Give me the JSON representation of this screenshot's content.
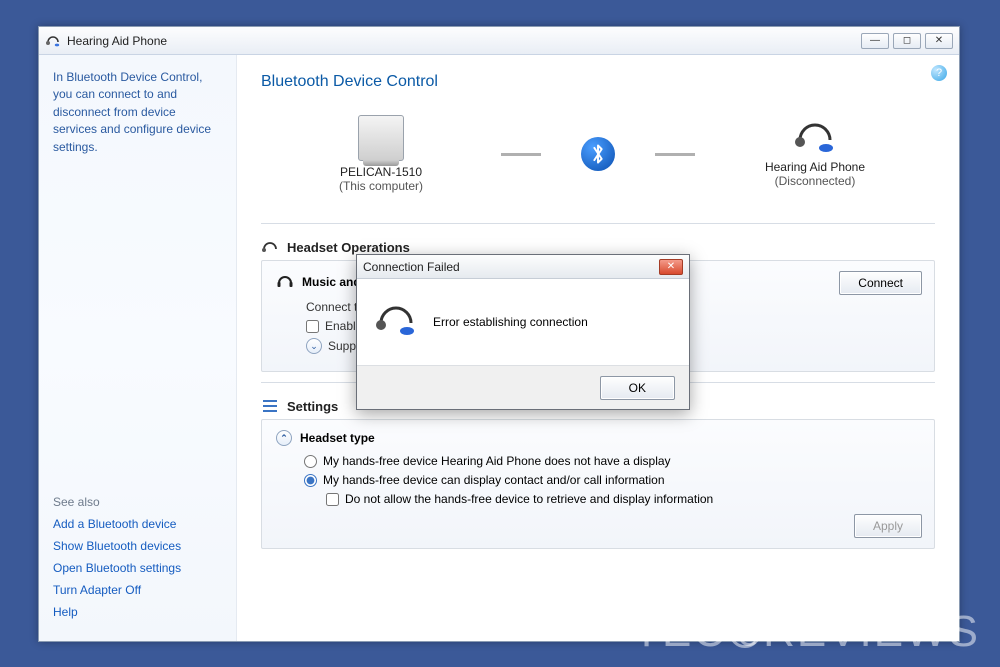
{
  "window": {
    "title": "Hearing Aid Phone",
    "help_tooltip": "?"
  },
  "sidebar": {
    "blurb": "In Bluetooth Device Control, you can connect to and disconnect from device services and configure device settings.",
    "see_also_label": "See also",
    "links": [
      "Add a Bluetooth device",
      "Show Bluetooth devices",
      "Open Bluetooth settings",
      "Turn Adapter Off",
      "Help"
    ]
  },
  "main": {
    "title": "Bluetooth Device Control",
    "device_left": {
      "name": "PELICAN-1510",
      "sub": "(This computer)"
    },
    "device_right": {
      "name": "Hearing Aid Phone",
      "sub": "(Disconnected)"
    },
    "headset_operations_label": "Headset Operations",
    "music_audio_label": "Music and Audio",
    "connect_line": "Connect to the B",
    "enable_speech": "Enable spee",
    "supported_line": "Supported A",
    "connect_btn": "Connect",
    "settings_label": "Settings",
    "headset_type_label": "Headset type",
    "radio1": "My hands-free device Hearing Aid Phone does not have a display",
    "radio2": "My hands-free device can display contact and/or call information",
    "check1": "Do not allow the hands-free device to retrieve and display information",
    "apply_btn": "Apply"
  },
  "dialog": {
    "title": "Connection Failed",
    "message": "Error establishing connection",
    "ok": "OK"
  },
  "watermark": {
    "left": "TEC",
    "right": "REVIEWS"
  }
}
